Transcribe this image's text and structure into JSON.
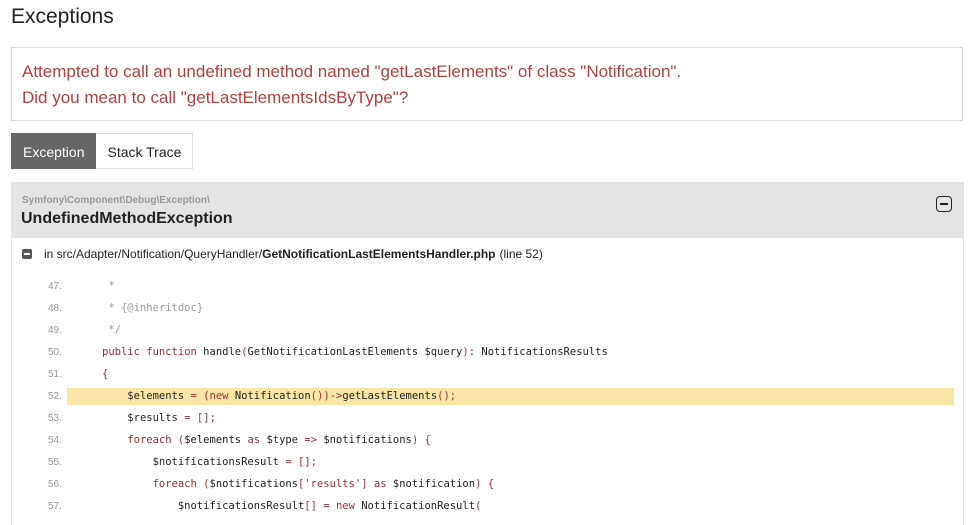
{
  "page": {
    "title": "Exceptions"
  },
  "message": {
    "line1": "Attempted to call an undefined method named \"getLastElements\" of class \"Notification\".",
    "line2": "Did you mean to call \"getLastElementsIdsByType\"?"
  },
  "tabs": [
    {
      "label": "Exception",
      "active": true
    },
    {
      "label": "Stack Trace",
      "active": false
    }
  ],
  "trace": {
    "namespace": "Symfony\\Component\\Debug\\Exception\\",
    "class": "UndefinedMethodException",
    "file_prefix": "in src/Adapter/Notification/QueryHandler/",
    "file_name": "GetNotificationLastElementsHandler.php",
    "line_info": "(line 52)",
    "highlight_line": "52.",
    "lines": [
      {
        "number": "47.",
        "code": "     *"
      },
      {
        "number": "48.",
        "code": "     * {@inheritdoc}"
      },
      {
        "number": "49.",
        "code": "     */"
      },
      {
        "number": "50.",
        "code": "    public function handle(GetNotificationLastElements $query): NotificationsResults"
      },
      {
        "number": "51.",
        "code": "    {"
      },
      {
        "number": "52.",
        "code": "        $elements = (new Notification())->getLastElements();"
      },
      {
        "number": "53.",
        "code": "        $results = [];"
      },
      {
        "number": "54.",
        "code": "        foreach ($elements as $type => $notifications) {"
      },
      {
        "number": "55.",
        "code": "            $notificationsResult = [];"
      },
      {
        "number": "56.",
        "code": "            foreach ($notifications['results'] as $notification) {"
      },
      {
        "number": "57.",
        "code": "                $notificationsResult[] = new NotificationResult("
      }
    ]
  }
}
